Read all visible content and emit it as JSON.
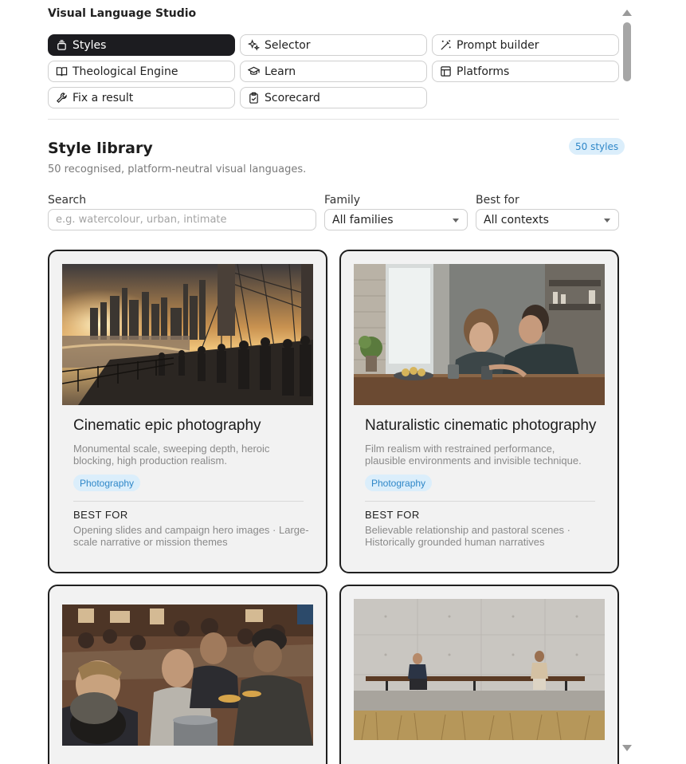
{
  "app": {
    "title": "Visual Language Studio"
  },
  "nav": [
    {
      "label": "Styles",
      "icon": "layers-icon",
      "active": true
    },
    {
      "label": "Selector",
      "icon": "sparkles-icon",
      "active": false
    },
    {
      "label": "Prompt builder",
      "icon": "magic-wand-icon",
      "active": false
    },
    {
      "label": "Theological Engine",
      "icon": "book-open-icon",
      "active": false
    },
    {
      "label": "Learn",
      "icon": "graduation-cap-icon",
      "active": false
    },
    {
      "label": "Platforms",
      "icon": "layout-icon",
      "active": false
    },
    {
      "label": "Fix a result",
      "icon": "wrench-icon",
      "active": false
    },
    {
      "label": "Scorecard",
      "icon": "clipboard-check-icon",
      "active": false
    }
  ],
  "library": {
    "title": "Style library",
    "subtitle": "50 recognised, platform-neutral visual languages.",
    "count_badge": "50 styles"
  },
  "filters": {
    "search_label": "Search",
    "search_placeholder": "e.g. watercolour, urban, intimate",
    "search_value": "",
    "family_label": "Family",
    "family_value": "All families",
    "best_for_label": "Best for",
    "best_for_value": "All contexts"
  },
  "cards": [
    {
      "title": "Cinematic epic photography",
      "description": "Monumental scale, sweeping depth, heroic blocking, high production realism.",
      "tag": "Photography",
      "best_for_label": "BEST FOR",
      "best_for": "Opening slides and campaign hero images · Large-scale narrative or mission themes",
      "image": "bridge-crowd-sunset-photo"
    },
    {
      "title": "Naturalistic cinematic photography",
      "description": "Film realism with restrained performance, plausible environments and invisible technique.",
      "tag": "Photography",
      "best_for_label": "BEST FOR",
      "best_for": "Believable relationship and pastoral scenes · Historically grounded human narratives",
      "image": "kitchen-conversation-photo"
    },
    {
      "title": "",
      "description": "",
      "tag": "",
      "best_for_label": "",
      "best_for": "",
      "image": "community-kitchen-photo"
    },
    {
      "title": "",
      "description": "",
      "tag": "",
      "best_for_label": "",
      "best_for": "",
      "image": "bench-concrete-wall-photo"
    }
  ],
  "colors": {
    "accent_badge_bg": "#dbeefb",
    "accent_badge_text": "#2f87c8",
    "active_nav_bg": "#1c1c20",
    "card_bg": "#f2f2f2"
  }
}
